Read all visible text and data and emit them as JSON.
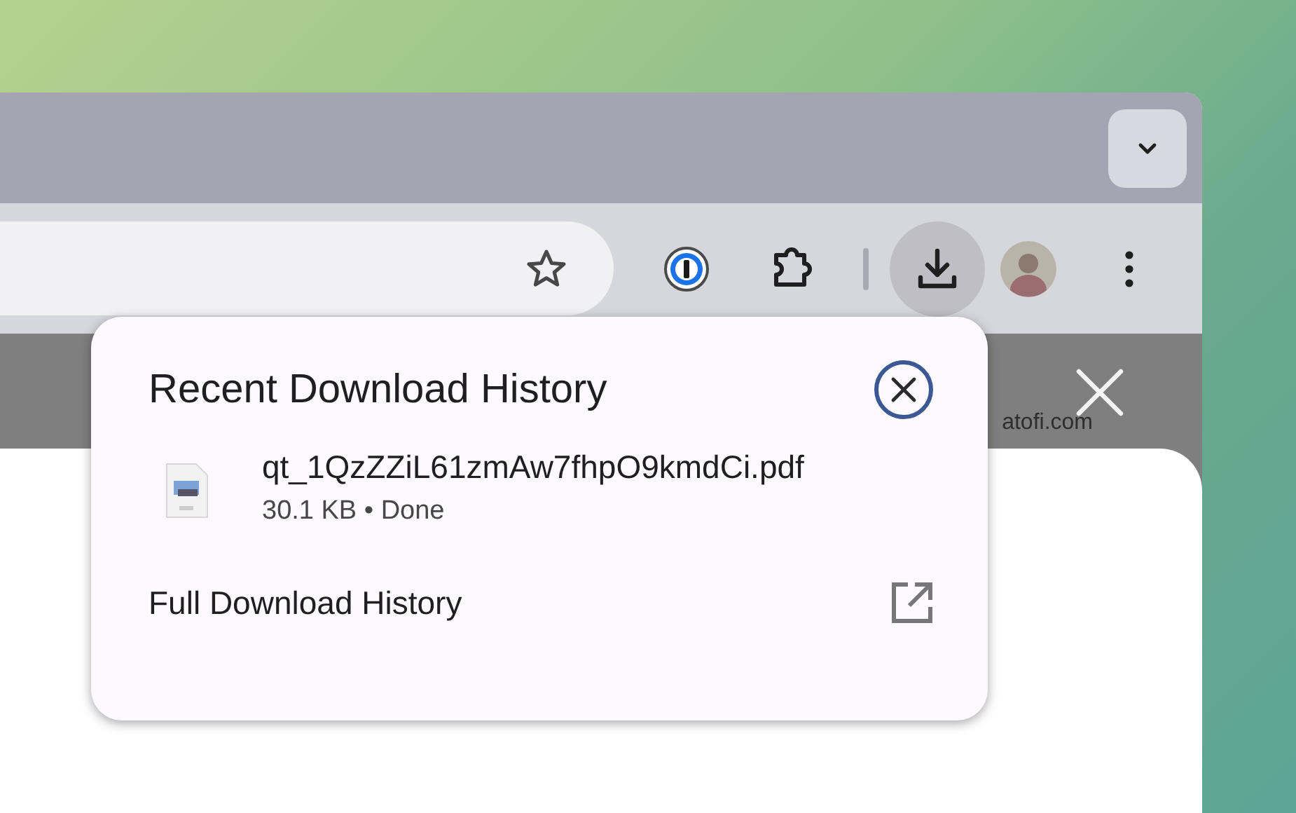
{
  "page": {
    "site_text": "atofi.com"
  },
  "download_popup": {
    "title": "Recent Download History",
    "items": [
      {
        "file_name": "qt_1QzZZiL61zmAw7fhpO9kmdCi.pdf",
        "details": "30.1 KB • Done"
      }
    ],
    "footer_link": "Full Download History"
  }
}
